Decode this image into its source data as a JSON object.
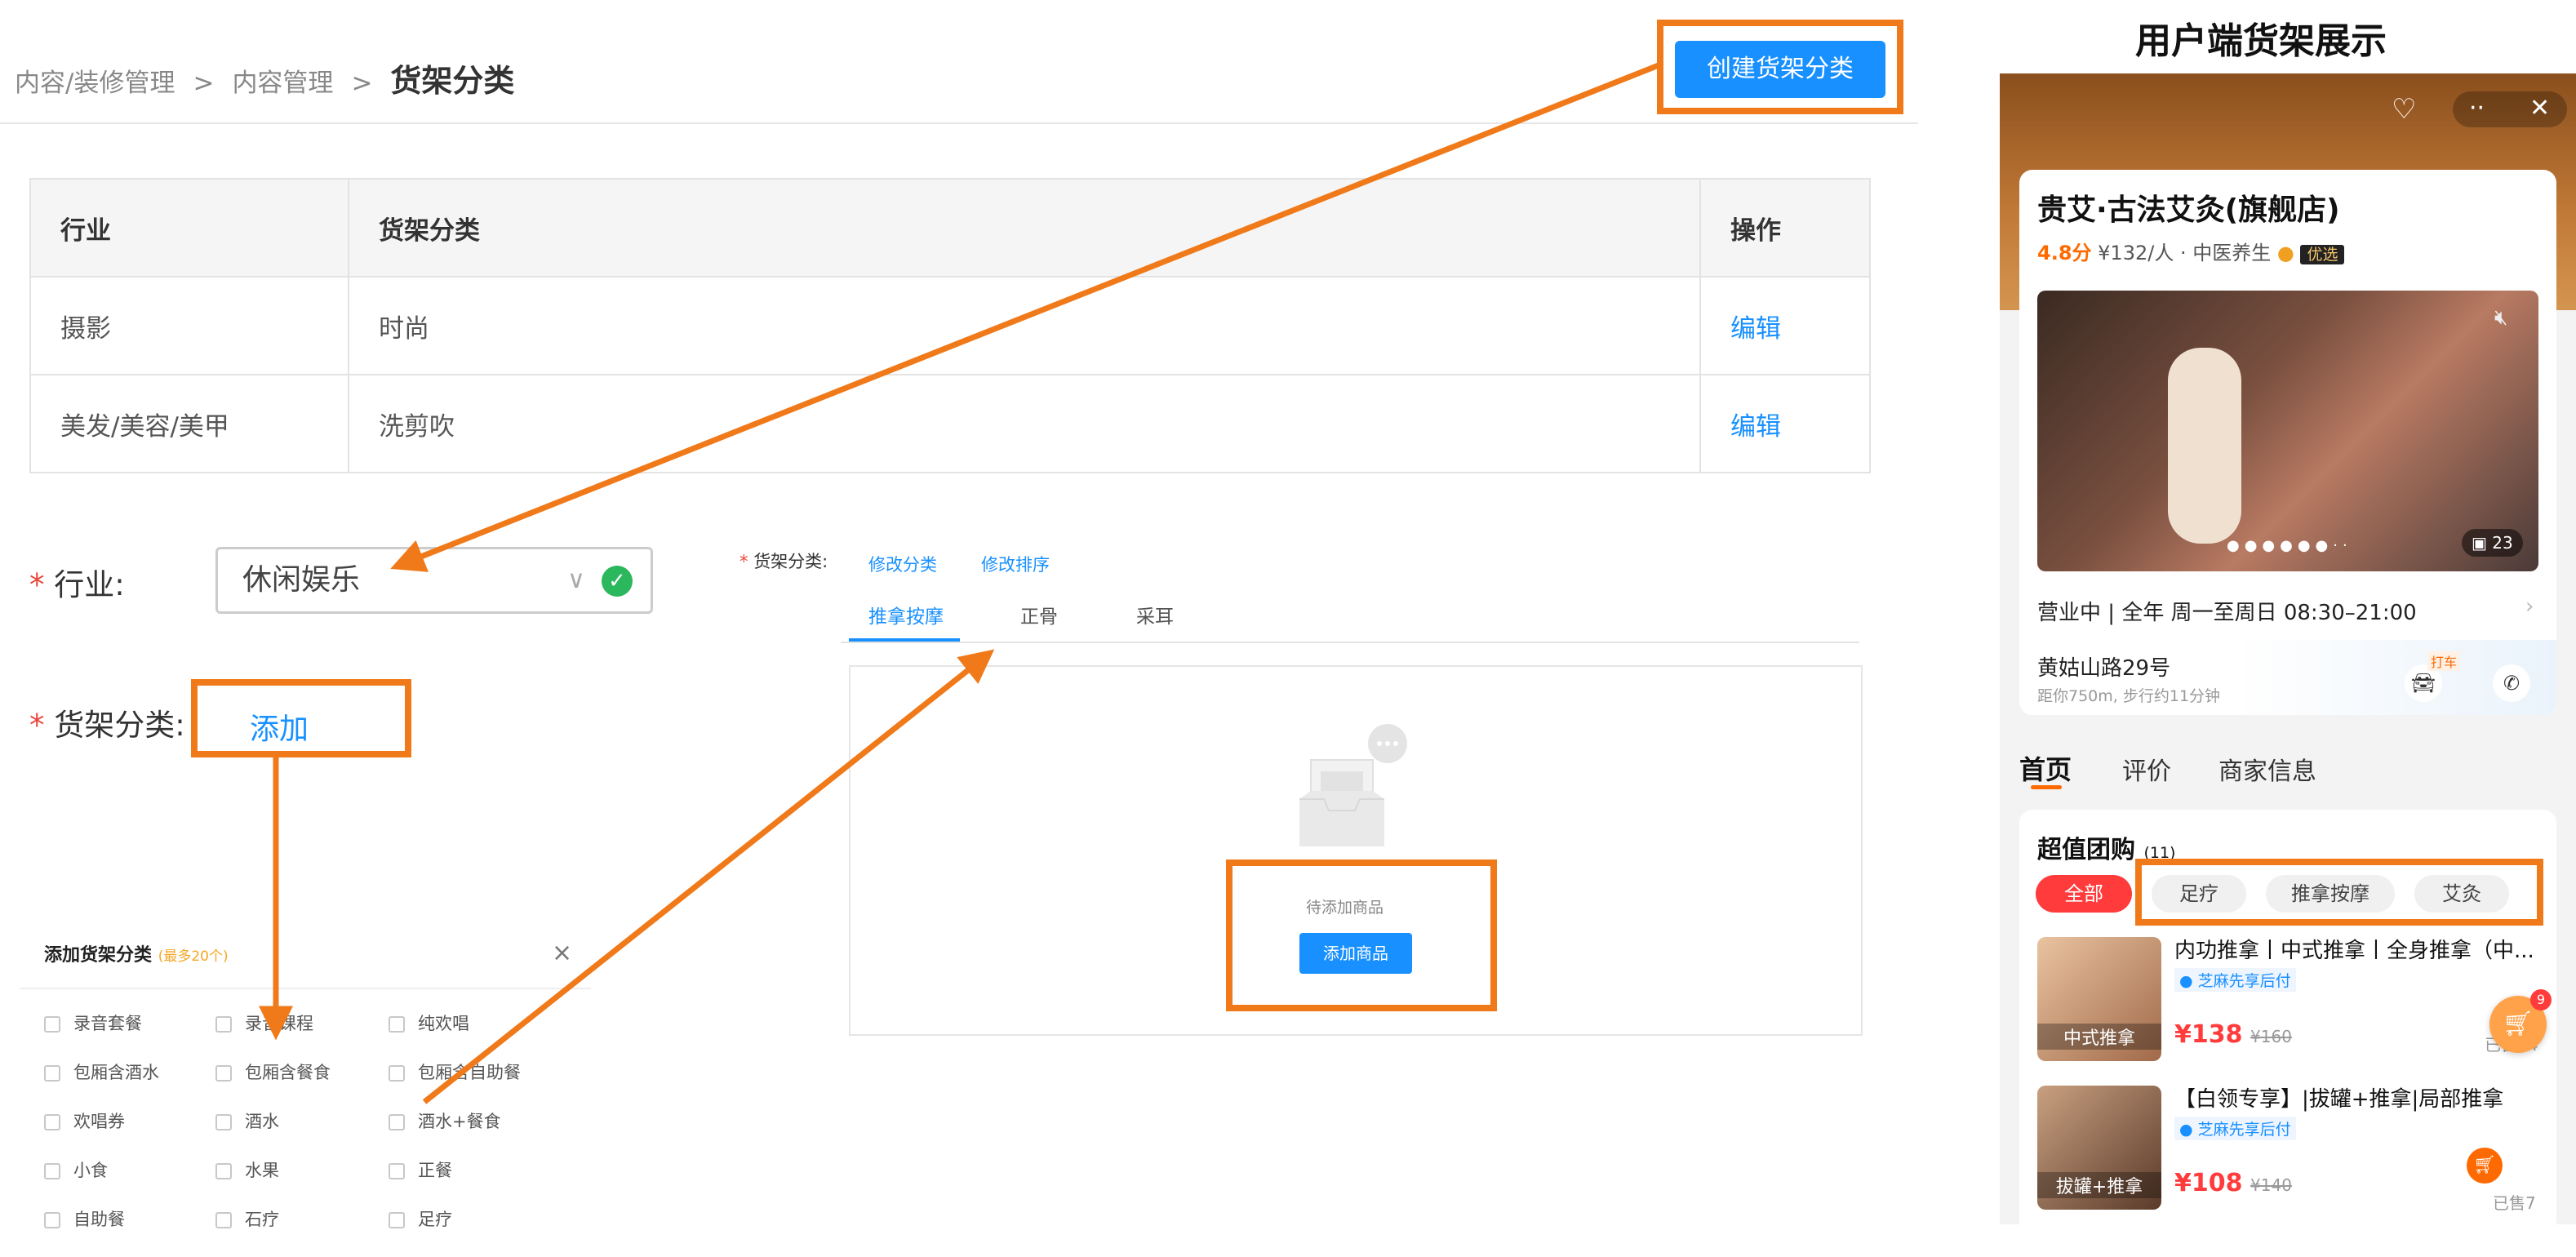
{
  "breadcrumb": {
    "level1": "内容/装修管理",
    "sep1": ">",
    "level2": "内容管理",
    "sep2": ">",
    "current": "货架分类"
  },
  "header": {
    "create_button": "创建货架分类"
  },
  "table": {
    "columns": [
      "行业",
      "货架分类",
      "操作"
    ],
    "rows": [
      {
        "industry": "摄影",
        "category": "时尚",
        "action": "编辑"
      },
      {
        "industry": "美发/美容/美甲",
        "category": "洗剪吹",
        "action": "编辑"
      }
    ]
  },
  "form": {
    "required_mark": "*",
    "industry_label": "行业:",
    "industry_value": "休闲娱乐",
    "category_label": "货架分类:",
    "add_link": "添加",
    "shelf_label": "货架分类:",
    "edit_category_link": "修改分类",
    "edit_order_link": "修改排序",
    "tabs": [
      "推拿按摩",
      "正骨",
      "采耳"
    ],
    "empty_text": "待添加商品",
    "add_product_button": "添加商品"
  },
  "dialog": {
    "title": "添加货架分类",
    "hint": "(最多20个)",
    "close": "×",
    "options": [
      [
        "录音套餐",
        "录音课程",
        "纯欢唱"
      ],
      [
        "包厢含酒水",
        "包厢含餐食",
        "包厢含自助餐"
      ],
      [
        "欢唱券",
        "酒水",
        "酒水+餐食"
      ],
      [
        "小食",
        "水果",
        "正餐"
      ],
      [
        "自助餐",
        "石疗",
        "足疗"
      ]
    ]
  },
  "preview": {
    "heading": "用户端货架展示",
    "store_name": "贵艾·古法艾灸(旗舰店)",
    "rating": "4.8分",
    "price_per": "¥132/人 · 中医养生",
    "badge": "优选",
    "photo_count": "23",
    "hours_status": "营业中",
    "hours": "全年 周一至周日 08:30–21:00",
    "address": "黄姑山路29号",
    "distance": "距你750m, 步行约11分钟",
    "taxi": "打车",
    "nav_tabs": [
      "首页",
      "评价",
      "商家信息"
    ],
    "section_title": "超值团购",
    "section_count": "(11)",
    "filters": [
      "全部",
      "足疗",
      "推拿按摩",
      "艾灸"
    ],
    "deals": [
      {
        "title": "内功推拿丨中式推拿丨全身推拿（中...",
        "pay": "芝麻先享后付",
        "img_label": "中式推拿",
        "price": "¥138",
        "old_price": "¥160",
        "sold": "已售14"
      },
      {
        "title": "【白领专享】|拔罐+推拿|局部推拿",
        "pay": "芝麻先享后付",
        "img_label": "拔罐+推拿",
        "price": "¥108",
        "old_price": "¥140",
        "sold": "已售7"
      }
    ],
    "cart_count": "9",
    "colors": {
      "accent": "#ff6a00",
      "orange_annotation": "#f07a1a",
      "primary_blue": "#1890ff"
    }
  }
}
